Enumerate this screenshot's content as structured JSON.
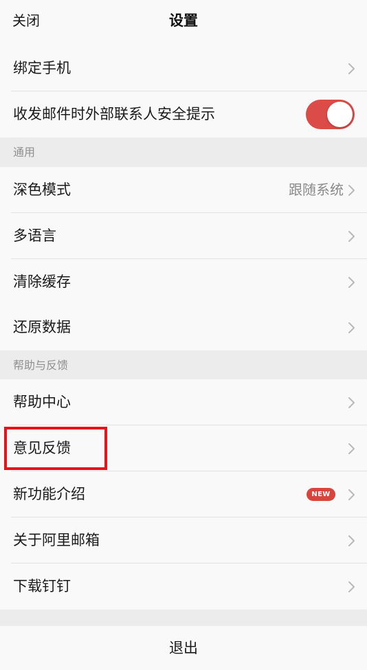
{
  "nav": {
    "close_label": "关闭",
    "title": "设置"
  },
  "account": {
    "bind_phone": "绑定手机",
    "external_contact_tip": "收发邮件时外部联系人安全提示",
    "external_contact_tip_enabled": true
  },
  "general": {
    "section_title": "通用",
    "dark_mode": "深色模式",
    "dark_mode_value": "跟随系统",
    "language": "多语言",
    "clear_cache": "清除缓存",
    "restore_data": "还原数据"
  },
  "help": {
    "section_title": "帮助与反馈",
    "help_center": "帮助中心",
    "feedback": "意见反馈",
    "new_features": "新功能介绍",
    "new_badge": "NEW",
    "about": "关于阿里邮箱",
    "download_dingtalk": "下载钉钉"
  },
  "logout_label": "退出",
  "colors": {
    "toggle_on": "#db4b48",
    "badge": "#d8453d",
    "highlight_box": "#e8141a"
  },
  "icons": {
    "row_arrow": "chevron-right-icon"
  }
}
